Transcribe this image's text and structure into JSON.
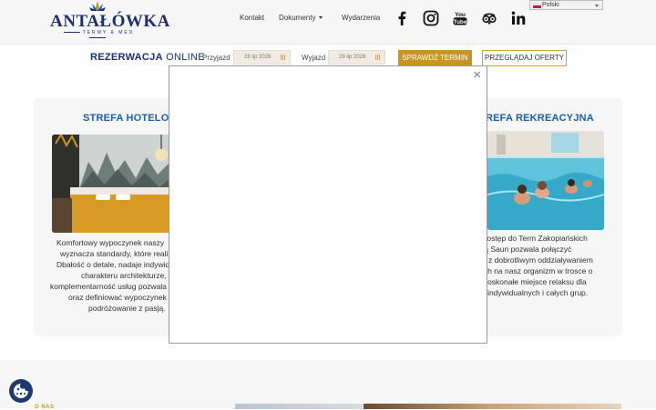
{
  "logo": {
    "name": "ANTAŁÓWKA",
    "tagline": "TERMY & MED"
  },
  "nav": {
    "contact": "Kontakt",
    "documents": "Dokumenty",
    "events": "Wydarzenia"
  },
  "social": [
    "facebook-icon",
    "instagram-icon",
    "youtube-icon",
    "tripadvisor-icon",
    "linkedin-icon"
  ],
  "language": {
    "selected": "Polski"
  },
  "reservation": {
    "title_bold": "REZERWACJA",
    "title_rest": " ONLINE",
    "arrival_label": "Przyjazd",
    "arrival_value": "28 lip 2026",
    "departure_label": "Wyjazd",
    "departure_value": "29 lip 2026",
    "check_button": "SPRAWDŹ TERMIN",
    "offers_button": "PRZEGLĄDAJ OFERTY"
  },
  "hotel_zone": {
    "title": "STREFA HOTELOWA",
    "lines": [
      "Komfortowy wypoczynek naszy",
      "wyznacza standardy, które reali",
      "Dbałość o detale, nadaje indywid",
      "charakteru architekturze,",
      "komplementarność usług pozwala",
      "oraz definiować wypoczynek",
      "podróżowanie z pasją."
    ]
  },
  "recreation_zone": {
    "title": "REFA REKREACYJNA",
    "lines": [
      "dni dostęp do Term Zakopiańskich",
      "trefą Saun pozwala połączyć",
      "nek z dobrotliwym oddziaływaniem",
      "lnych na nasz organizm w trosce o",
      "To doskonałe miejsce relaksu dla",
      "sób indywidualnych i całych grup."
    ]
  },
  "modal": {
    "close": "×"
  },
  "about": {
    "label": "O NAS"
  },
  "colors": {
    "navy": "#1c2f6e",
    "title_blue": "#1c5ea8",
    "gold": "#c8961f"
  }
}
